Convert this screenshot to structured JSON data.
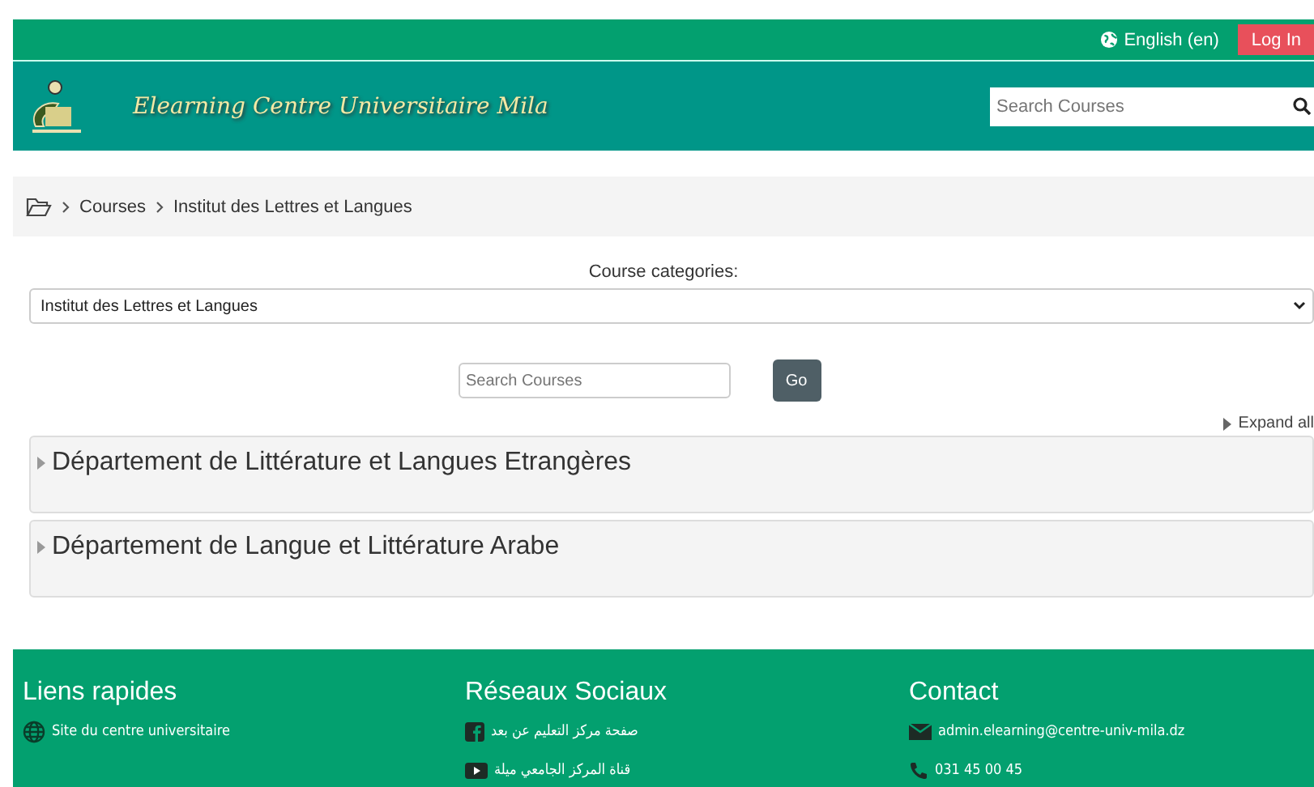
{
  "topbar": {
    "language": "English (en)",
    "login": "Log In"
  },
  "header": {
    "site_name": "Elearning Centre Universitaire Mila",
    "search": {
      "placeholder": "Search Courses"
    }
  },
  "breadcrumb": [
    "Courses",
    "Institut des Lettres et Langues"
  ],
  "categories_label": "Course categories:",
  "category_select": {
    "value": "Institut des Lettres et Langues"
  },
  "course_search": {
    "placeholder": "Search Courses",
    "button": "Go"
  },
  "expand_all": "Expand all",
  "categories": [
    {
      "name": "Département de Littérature et Langues Etrangères",
      "expanded": false
    },
    {
      "name": "Département de Langue et Littérature Arabe",
      "expanded": false
    }
  ],
  "footer": {
    "columns": [
      {
        "title": "Liens rapides",
        "links": [
          {
            "kind": "globe",
            "text": "Site du centre universitaire"
          }
        ]
      },
      {
        "title": "Réseaux Sociaux",
        "links": [
          {
            "kind": "facebook",
            "text": "صفحة مركز التعليم عن بعد"
          },
          {
            "kind": "youtube",
            "text": "قناة المركز الجامعي ميلة"
          }
        ]
      },
      {
        "title": "Contact",
        "links": [
          {
            "kind": "mail",
            "text": "admin.elearning@centre-univ-mila.dz"
          },
          {
            "kind": "phone",
            "text": "031 45 00 45"
          }
        ]
      }
    ]
  }
}
